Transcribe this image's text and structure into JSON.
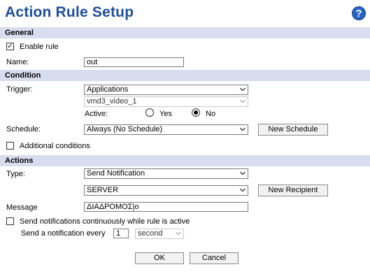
{
  "header": {
    "title": "Action Rule Setup",
    "help_icon": "?"
  },
  "general": {
    "section_label": "General",
    "enable_rule": {
      "label": "Enable rule",
      "checked": true
    },
    "name": {
      "label": "Name:",
      "value": "out"
    }
  },
  "condition": {
    "section_label": "Condition",
    "trigger": {
      "label": "Trigger:",
      "value": "Applications"
    },
    "trigger_sub": {
      "value": "vmd3_video_1"
    },
    "active": {
      "label": "Active:",
      "yes_label": "Yes",
      "no_label": "No",
      "selected": "No"
    },
    "schedule": {
      "label": "Schedule:",
      "value": "Always (No Schedule)",
      "new_button": "New Schedule"
    },
    "additional": {
      "label": "Additional conditions",
      "checked": false
    }
  },
  "actions": {
    "section_label": "Actions",
    "type": {
      "label": "Type:",
      "value": "Send Notification"
    },
    "recipient": {
      "value": "SERVER",
      "new_button": "New Recipient"
    },
    "message": {
      "label": "Message",
      "value": "ΔΙΑΔΡΟΜΟΣ|o"
    },
    "continuous": {
      "label": "Send notifications continuously while rule is active",
      "checked": false
    },
    "every": {
      "label": "Send a notification every",
      "value": "1",
      "unit": "second"
    }
  },
  "footer": {
    "ok": "OK",
    "cancel": "Cancel"
  }
}
